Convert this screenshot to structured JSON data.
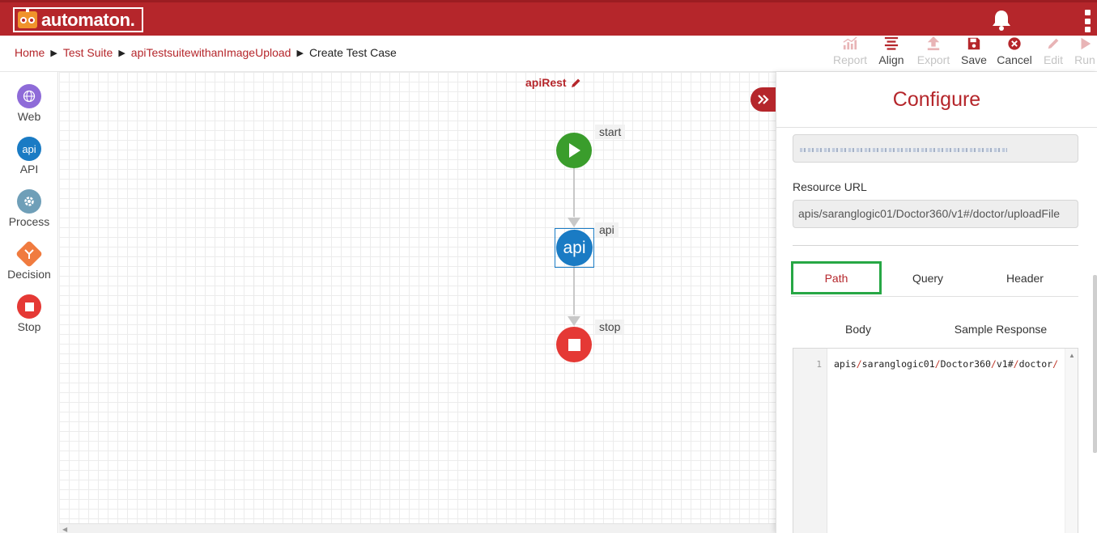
{
  "app": {
    "logo_text": "automaton."
  },
  "breadcrumb": {
    "items": [
      "Home",
      "Test Suite",
      "apiTestsuitewithanImageUpload"
    ],
    "current": "Create Test Case"
  },
  "toolbar": {
    "report": "Report",
    "align": "Align",
    "export": "Export",
    "save": "Save",
    "cancel": "Cancel",
    "edit": "Edit",
    "run": "Run"
  },
  "palette": {
    "web": "Web",
    "api": "API",
    "process": "Process",
    "decision": "Decision",
    "stop": "Stop",
    "api_icon_text": "api"
  },
  "canvas": {
    "title": "apiRest",
    "nodes": {
      "start": "start",
      "api": "api",
      "api_icon_text": "api",
      "stop": "stop"
    }
  },
  "panel": {
    "title": "Configure",
    "resource_url_label": "Resource URL",
    "resource_url_value": "apis/saranglogic01/Doctor360/v1#/doctor/uploadFile",
    "tabs": {
      "path": "Path",
      "query": "Query",
      "header": "Header"
    },
    "subtabs": {
      "body": "Body",
      "sample": "Sample Response"
    },
    "editor": {
      "line_number": "1",
      "segments": [
        "apis",
        "/",
        "saranglogic01",
        "/",
        "Doctor360",
        "/",
        "v1#",
        "/",
        "doctor",
        "/"
      ]
    }
  },
  "colors": {
    "brand": "#b5262b",
    "start": "#3a9d2c",
    "api": "#1a7bc4",
    "stop": "#e53935",
    "highlight": "#27a745"
  }
}
